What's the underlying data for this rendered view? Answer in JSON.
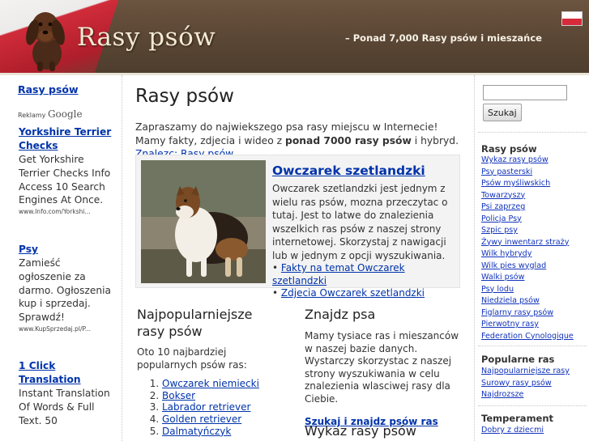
{
  "header": {
    "site_title": "Rasy psów",
    "tagline": "– Ponad 7,000 Rasy psów  i mieszańce"
  },
  "left": {
    "heading": "Rasy psów",
    "reklamy_prefix": "Reklamy",
    "reklamy_brand": "Google",
    "ads": [
      {
        "title": "Yorkshire Terrier Checks",
        "desc": "Get Yorkshire Terrier Checks Info Access 10 Search Engines At Once.",
        "url": "www.Info.com/Yorkshi..."
      },
      {
        "title": "Psy",
        "desc": "Zamieść ogłoszenie za darmo. Ogłoszenia kup i sprzedaj. Sprawdź!",
        "url": "www.KupSprzedaj.pl/P..."
      },
      {
        "title": "1 Click Translation",
        "desc": "Instant Translation Of Words & Full Text. 50",
        "url": ""
      }
    ]
  },
  "main": {
    "title": "Rasy psów",
    "intro_pre": "Zapraszamy do najwiekszego psa rasy miejscu w Internecie! Mamy fakty, zdjecia i wideo z ",
    "intro_bold": "ponad 7000 rasy psów",
    "intro_mid": " i hybryd. ",
    "intro_link": "Znalezc: Rasy psów",
    "featured": {
      "title": "Owczarek szetlandzki",
      "text": "Owczarek szetlandzki jest jednym z wielu ras psów, mozna przeczytac o tutaj. Jest to latwe do znalezienia wszelkich ras psów z naszej strony internetowej. Skorzystaj z nawigacji lub w jednym z opcji wyszukiwania.",
      "link_facts": "Fakty na temat Owczarek szetlandzki",
      "link_photos": "Zdjecia Owczarek szetlandzki",
      "bullet": "•"
    },
    "popular": {
      "heading": "Najpopularniejsze rasy psów",
      "desc": "Oto 10 najbardziej popularnych psów ras:",
      "items": [
        "Owczarek niemiecki",
        "Bokser",
        "Labrador retriever",
        "Golden retriever",
        "Dalmatyńczyk"
      ]
    },
    "find": {
      "heading": "Znajdz psa",
      "desc": "Mamy tysiace ras i mieszanców w naszej bazie danych. Wystarczy skorzystac z naszej strony wyszukiwania w celu znalezienia wlasciwej rasy dla Ciebie.",
      "link": "Szukaj i znajdz psów ras"
    },
    "list_heading": "Wykaz rasy psów"
  },
  "right": {
    "search_value": "",
    "search_button": "Szukaj",
    "sections": [
      {
        "heading": "Rasy psów",
        "links": [
          "Wykaz rasy psów",
          "Psy pasterski",
          "Psów myśliwskich",
          "Towarzyszy",
          "Psi zaprzeg",
          "Policja Psy",
          "Szpic psy",
          "Żywy inwentarz straży",
          "Wilk hybrydy",
          "Wilk pies wyglad",
          "Walki psów",
          "Psy lodu",
          "Niedziela psów",
          "Figlarny rasy psów",
          "Pierwotny rasy",
          "Federation Cynologique"
        ]
      },
      {
        "heading": "Popularne ras",
        "links": [
          "Najpopularniejsze rasy",
          "Surowy rasy psów",
          "Najdrozsze"
        ]
      },
      {
        "heading": "Temperament",
        "links": [
          "Dobry z dziecmi"
        ]
      }
    ]
  }
}
